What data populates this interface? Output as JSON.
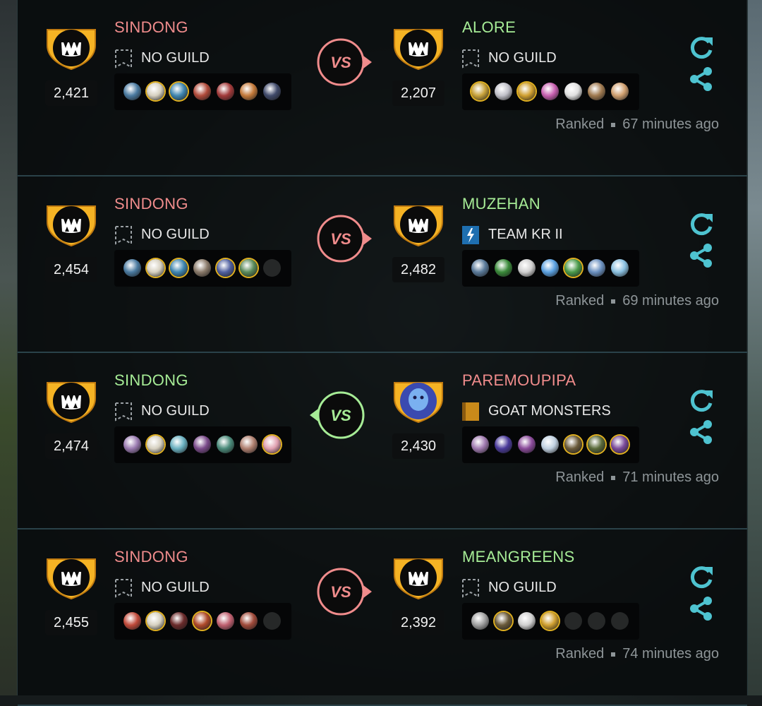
{
  "colors": {
    "loss_name": "#f08c8c",
    "win_name": "#a6ec96",
    "loss_vs": "#f08c8c",
    "win_vs": "#a6ec96",
    "accent_icon": "#4ec3d0",
    "shield_gold": "#f5b324"
  },
  "battles": [
    {
      "left": {
        "name": "SINDONG",
        "name_color": "#f08c8c",
        "guild": "NO GUILD",
        "guild_icon": "no-guild-icon",
        "rating": "2,421",
        "avatar": "fang-shield-icon",
        "team": [
          "#4a7aa0",
          "#d6d0c0",
          "#3f86b0",
          "#b04a3a",
          "#a23a3a",
          "#c47a3a",
          "#404a6a"
        ],
        "gold": [
          1,
          2
        ]
      },
      "right": {
        "name": "ALORE",
        "name_color": "#a6ec96",
        "guild": "NO GUILD",
        "guild_icon": "no-guild-icon",
        "rating": "2,207",
        "avatar": "fang-shield-icon",
        "team": [
          "#c8a23a",
          "#c0c0c8",
          "#d0a030",
          "#c860b0",
          "#e0e0e0",
          "#a07a50",
          "#d0a070"
        ],
        "gold": [
          0,
          2
        ]
      },
      "winner": "right",
      "status": "Ranked",
      "time": "67 minutes ago"
    },
    {
      "left": {
        "name": "SINDONG",
        "name_color": "#f08c8c",
        "guild": "NO GUILD",
        "guild_icon": "no-guild-icon",
        "rating": "2,454",
        "avatar": "fang-shield-icon",
        "team": [
          "#4a7aa0",
          "#d6d0c0",
          "#3f86b0",
          "#8a7a6a",
          "#5060a0",
          "#5a8a5a",
          ""
        ],
        "gold": [
          1,
          2,
          4,
          5
        ]
      },
      "right": {
        "name": "MUZEHAN",
        "name_color": "#a6ec96",
        "guild": "TEAM KR II",
        "guild_icon": "lightning-banner-icon",
        "rating": "2,482",
        "avatar": "fang-shield-icon",
        "team": [
          "#5a7a9a",
          "#3a8a3a",
          "#d0d0d0",
          "#5aa0e0",
          "#4a9a4a",
          "#6a90c0",
          "#8ac0e0"
        ],
        "gold": [
          4
        ]
      },
      "winner": "right",
      "status": "Ranked",
      "time": "69 minutes ago"
    },
    {
      "left": {
        "name": "SINDONG",
        "name_color": "#a6ec96",
        "guild": "NO GUILD",
        "guild_icon": "no-guild-icon",
        "rating": "2,474",
        "avatar": "fang-shield-icon",
        "team": [
          "#9a7ab0",
          "#d6d0c0",
          "#6ab0c0",
          "#7a4a8a",
          "#4a8a7a",
          "#b08070",
          "#e0a0b0"
        ],
        "gold": [
          1,
          6
        ]
      },
      "right": {
        "name": "PAREMOUPIPA",
        "name_color": "#f08c8c",
        "guild": "GOAT MONSTERS",
        "guild_icon": "gold-banner-icon",
        "rating": "2,430",
        "avatar": "ghost-shield-icon",
        "team": [
          "#a07ab0",
          "#4a3a9a",
          "#8a4a9a",
          "#c0d0e0",
          "#6a5a3a",
          "#5a6a3a",
          "#7a4a9a"
        ],
        "gold": [
          4,
          5,
          6
        ]
      },
      "winner": "left",
      "status": "Ranked",
      "time": "71 minutes ago"
    },
    {
      "left": {
        "name": "SINDONG",
        "name_color": "#f08c8c",
        "guild": "NO GUILD",
        "guild_icon": "no-guild-icon",
        "rating": "2,455",
        "avatar": "fang-shield-icon",
        "team": [
          "#c04a3a",
          "#d6d0c0",
          "#6a2a2a",
          "#b04a2a",
          "#c06070",
          "#a04a3a",
          ""
        ],
        "gold": [
          1,
          3
        ]
      },
      "right": {
        "name": "MEANGREENS",
        "name_color": "#a6ec96",
        "guild": "NO GUILD",
        "guild_icon": "no-guild-icon",
        "rating": "2,392",
        "avatar": "fang-shield-icon",
        "team": [
          "#a0a0a0",
          "#6a5a3a",
          "#d0d0d0",
          "#d0a030",
          "",
          "",
          ""
        ],
        "gold": [
          1,
          3
        ]
      },
      "winner": "right",
      "status": "Ranked",
      "time": "74 minutes ago"
    }
  ],
  "vs_label": "VS"
}
